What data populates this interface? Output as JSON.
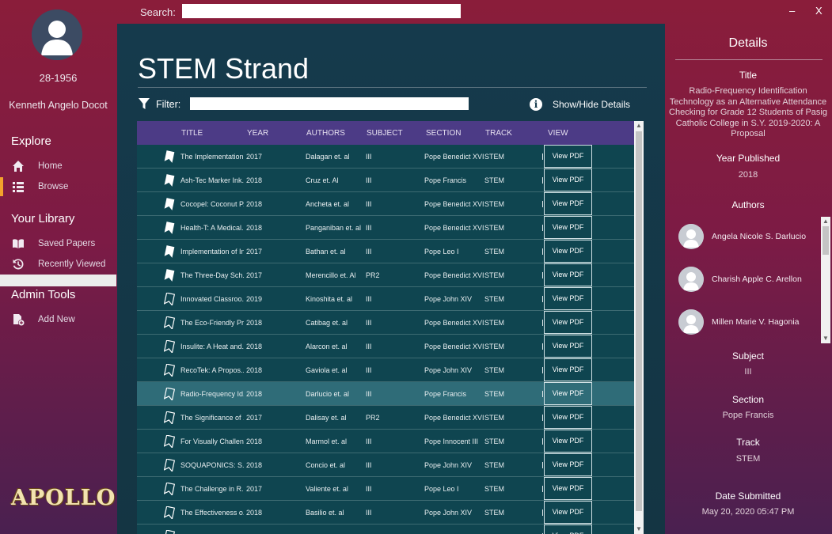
{
  "window": {
    "minimize_label": "–",
    "close_label": "X"
  },
  "search": {
    "label": "Search:",
    "value": ""
  },
  "user": {
    "id": "28-1956",
    "name": "Kenneth Angelo Docot"
  },
  "sidebar": {
    "explore_label": "Explore",
    "explore_items": [
      {
        "label": "Home",
        "icon": "home-icon"
      },
      {
        "label": "Browse",
        "icon": "list-icon"
      }
    ],
    "library_label": "Your Library",
    "library_items": [
      {
        "label": "Saved Papers",
        "icon": "book-icon"
      },
      {
        "label": "Recently Viewed",
        "icon": "history-icon"
      }
    ],
    "admin_label": "Admin Tools",
    "admin_items": [
      {
        "label": "Add New",
        "icon": "add-file-icon"
      }
    ],
    "logo": "APOLLO"
  },
  "main": {
    "title": "STEM Strand",
    "filter_label": "Filter:",
    "filter_value": "",
    "toggle_details": "Show/Hide Details"
  },
  "table": {
    "headers": [
      "TITLE",
      "YEAR",
      "AUTHORS",
      "SUBJECT",
      "SECTION",
      "TRACK",
      "VIEW"
    ],
    "view_button": "View PDF",
    "rows": [
      {
        "saved": true,
        "title": "The Implementation...",
        "year": "2017",
        "authors": "Dalagan et. al",
        "subject": "III",
        "section": "Pope Benedict XVI",
        "track": "STEM"
      },
      {
        "saved": true,
        "title": "Ash-Tec Marker Ink...",
        "year": "2018",
        "authors": "Cruz et. Al",
        "subject": "III",
        "section": "Pope Francis",
        "track": "STEM"
      },
      {
        "saved": true,
        "title": "Cocopel: Coconut P...",
        "year": "2018",
        "authors": "Ancheta et. al",
        "subject": "III",
        "section": "Pope Benedict XVI",
        "track": "STEM"
      },
      {
        "saved": true,
        "title": "Health-T: A Medical...",
        "year": "2018",
        "authors": "Panganiban et. al",
        "subject": "III",
        "section": "Pope Benedict XVI",
        "track": "STEM"
      },
      {
        "saved": true,
        "title": "Implementation of In...",
        "year": "2017",
        "authors": "Bathan et. al",
        "subject": "III",
        "section": "Pope Leo I",
        "track": "STEM"
      },
      {
        "saved": true,
        "title": "The Three-Day Sch...",
        "year": "2017",
        "authors": "Merencillo et. Al",
        "subject": "PR2",
        "section": "Pope Benedict XVI",
        "track": "STEM"
      },
      {
        "saved": false,
        "title": "Innovated Classroo...",
        "year": "2019",
        "authors": "Kinoshita et. al",
        "subject": "III",
        "section": "Pope John XIV",
        "track": "STEM"
      },
      {
        "saved": false,
        "title": "The Eco-Friendly Pr...",
        "year": "2018",
        "authors": "Catibag et. al",
        "subject": "III",
        "section": "Pope Benedict XVI",
        "track": "STEM"
      },
      {
        "saved": false,
        "title": "Insulite: A Heat and...",
        "year": "2018",
        "authors": "Alarcon et. al",
        "subject": "III",
        "section": "Pope Benedict XVI",
        "track": "STEM"
      },
      {
        "saved": false,
        "title": "RecoTek: A Propos...",
        "year": "2018",
        "authors": "Gaviola et. al",
        "subject": "III",
        "section": "Pope John XIV",
        "track": "STEM"
      },
      {
        "saved": false,
        "title": "Radio-Frequency Id...",
        "year": "2018",
        "authors": "Darlucio et. al",
        "subject": "III",
        "section": "Pope Francis",
        "track": "STEM",
        "selected": true
      },
      {
        "saved": false,
        "title": "The Significance of ...",
        "year": "2017",
        "authors": "Dalisay et. al",
        "subject": "PR2",
        "section": "Pope Benedict XVI",
        "track": "STEM"
      },
      {
        "saved": false,
        "title": "For Visually Challen...",
        "year": "2018",
        "authors": "Marmol et. al",
        "subject": "III",
        "section": "Pope Innocent III",
        "track": "STEM"
      },
      {
        "saved": false,
        "title": "SOQUAPONICS: S...",
        "year": "2018",
        "authors": "Concio et. al",
        "subject": "III",
        "section": "Pope John XIV",
        "track": "STEM"
      },
      {
        "saved": false,
        "title": "The Challenge in R...",
        "year": "2017",
        "authors": "Valiente et. al",
        "subject": "III",
        "section": "Pope Leo I",
        "track": "STEM"
      },
      {
        "saved": false,
        "title": "The Effectiveness o...",
        "year": "2018",
        "authors": "Basilio et. al",
        "subject": "III",
        "section": "Pope John XIV",
        "track": "STEM"
      },
      {
        "saved": false,
        "title": "",
        "year": "",
        "authors": "",
        "subject": "",
        "section": "",
        "track": ""
      }
    ]
  },
  "details": {
    "heading": "Details",
    "title_label": "Title",
    "title_value": "Radio-Frequency Identification Technology as an Alternative Attendance Checking for Grade 12 Students of Pasig Catholic College in S.Y. 2019-2020: A Proposal",
    "year_label": "Year Published",
    "year_value": "2018",
    "authors_label": "Authors",
    "authors": [
      "Angela Nicole S. Darlucio",
      "Charish Apple C. Arellon",
      "Millen Marie V. Hagonia"
    ],
    "subject_label": "Subject",
    "subject_value": "III",
    "section_label": "Section",
    "section_value": "Pope Francis",
    "track_label": "Track",
    "track_value": "STEM",
    "date_label": "Date Submitted",
    "date_value": "May 20, 2020 05:47 PM"
  },
  "colors": {
    "accent": "#f3a22c",
    "header_purple": "#4c3b86",
    "table_row": "#0f4550",
    "selected_row": "#2f6c78"
  }
}
